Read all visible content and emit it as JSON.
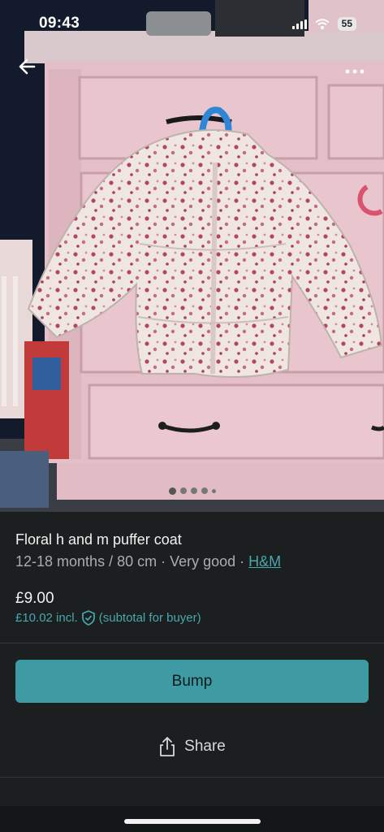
{
  "status_bar": {
    "time": "09:43",
    "battery": "55"
  },
  "listing": {
    "title": "Floral h and m puffer coat",
    "size_condition": "12-18 months / 80 cm · Very good · ",
    "brand": "H&M",
    "price": "£9.00",
    "total": "£10.02 incl.",
    "total_note": "(subtotal for buyer)"
  },
  "actions": {
    "bump_label": "Bump",
    "share_label": "Share"
  },
  "icons": [
    "back-arrow-icon",
    "more-icon",
    "shield-check-icon",
    "share-icon",
    "signal-icon",
    "wifi-icon"
  ],
  "colors": {
    "accent": "#3e9ba3",
    "link": "#48a8ae",
    "background": "#1b1f20"
  }
}
